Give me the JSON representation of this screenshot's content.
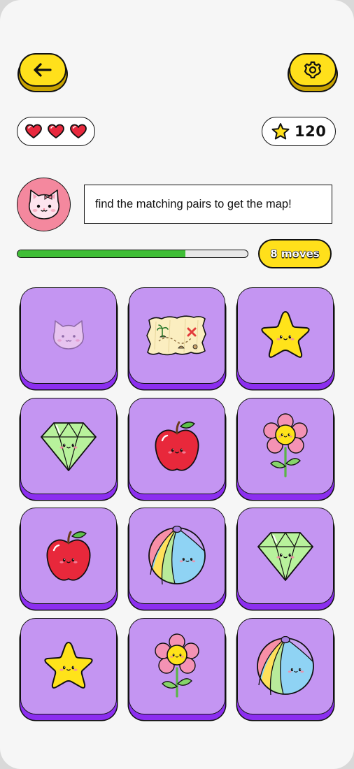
{
  "header": {
    "back_icon": "arrow-left-icon",
    "settings_icon": "gear-icon"
  },
  "status": {
    "lives": 3,
    "lives_icon": "heart-icon",
    "score": "120",
    "score_icon": "star-icon"
  },
  "guide": {
    "avatar": "cat-avatar",
    "message": "find the matching pairs to get the map!"
  },
  "progress": {
    "value": 0.73,
    "moves_label": "8 moves"
  },
  "board": {
    "columns": 3,
    "cards": [
      {
        "item": "cat",
        "state": "faded"
      },
      {
        "item": "treasure-map",
        "state": "revealed"
      },
      {
        "item": "star",
        "state": "revealed"
      },
      {
        "item": "diamond",
        "state": "revealed"
      },
      {
        "item": "apple",
        "state": "revealed"
      },
      {
        "item": "flower",
        "state": "revealed"
      },
      {
        "item": "apple",
        "state": "revealed"
      },
      {
        "item": "beach-ball",
        "state": "revealed"
      },
      {
        "item": "diamond",
        "state": "revealed"
      },
      {
        "item": "star",
        "state": "revealed"
      },
      {
        "item": "flower",
        "state": "revealed"
      },
      {
        "item": "beach-ball",
        "state": "revealed"
      }
    ]
  },
  "colors": {
    "accent_yellow": "#ffe01b",
    "card_purple": "#c495f2",
    "card_shadow": "#8c2ef0",
    "progress_green": "#3fbe36",
    "heart_red": "#e8293e",
    "avatar_pink": "#f4889e"
  }
}
